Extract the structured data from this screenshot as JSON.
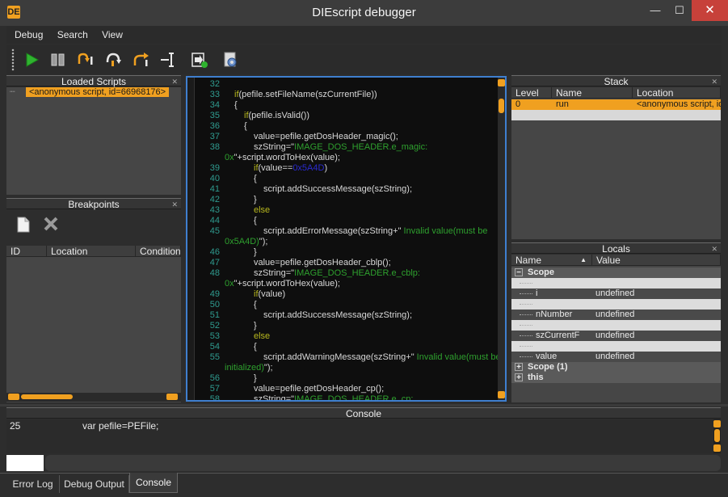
{
  "window": {
    "title": "DIEscript debugger",
    "app_icon": "DE",
    "minimize": "—",
    "maximize": "☐",
    "close": "✕"
  },
  "menu": [
    "Debug",
    "Search",
    "View"
  ],
  "toolbar": {
    "buttons": [
      "run-icon",
      "pause-icon",
      "step-over-icon",
      "step-into-icon",
      "step-out-icon",
      "run-to-cursor-icon",
      "insert-breakpoint-icon",
      "settings-icon"
    ]
  },
  "loaded_scripts": {
    "title": "Loaded Scripts",
    "items": [
      "<anonymous script, id=66968176>"
    ]
  },
  "breakpoints": {
    "title": "Breakpoints",
    "columns": [
      "ID",
      "Location",
      "Condition"
    ]
  },
  "stack": {
    "title": "Stack",
    "columns": [
      "Level",
      "Name",
      "Location"
    ],
    "rows": [
      {
        "level": "0",
        "name": "run",
        "location": "<anonymous script, id"
      }
    ]
  },
  "locals": {
    "title": "Locals",
    "columns": [
      "Name",
      "Value"
    ],
    "rows": [
      {
        "name": "Scope",
        "value": "",
        "bold": true,
        "expander": "−"
      },
      {
        "name": "",
        "value": "",
        "blank": true
      },
      {
        "name": "i",
        "value": "undefined"
      },
      {
        "name": "",
        "value": "",
        "blank": true
      },
      {
        "name": "nNumber",
        "value": "undefined"
      },
      {
        "name": "",
        "value": "",
        "blank": true
      },
      {
        "name": "szCurrentF",
        "value": "undefined"
      },
      {
        "name": "",
        "value": "",
        "blank": true
      },
      {
        "name": "value",
        "value": "undefined"
      },
      {
        "name": "Scope (1)",
        "value": "",
        "bold": true,
        "expander": "+"
      },
      {
        "name": "this",
        "value": "",
        "bold": true,
        "expander": "+"
      }
    ]
  },
  "code": [
    {
      "n": "32",
      "indent": 0,
      "parts": []
    },
    {
      "n": "33",
      "indent": 1,
      "parts": [
        [
          "kw",
          "if"
        ],
        [
          "t",
          "(pefile.setFileName(szCurrentFile))"
        ]
      ]
    },
    {
      "n": "34",
      "indent": 1,
      "parts": [
        [
          "t",
          "{"
        ]
      ]
    },
    {
      "n": "35",
      "indent": 2,
      "parts": [
        [
          "kw",
          "if"
        ],
        [
          "t",
          "(pefile.isValid())"
        ]
      ]
    },
    {
      "n": "36",
      "indent": 2,
      "parts": [
        [
          "t",
          "{"
        ]
      ]
    },
    {
      "n": "37",
      "indent": 3,
      "parts": [
        [
          "t",
          "value=pefile.getDosHeader_magic();"
        ]
      ]
    },
    {
      "n": "38",
      "indent": 3,
      "parts": [
        [
          "t",
          "szString=\""
        ],
        [
          "str",
          "IMAGE_DOS_HEADER.e_magic:"
        ]
      ]
    },
    {
      "n": "",
      "indent": 0,
      "parts": [
        [
          "str",
          "0x"
        ],
        [
          "t",
          "\"+script.wordToHex(value);"
        ]
      ]
    },
    {
      "n": "39",
      "indent": 3,
      "parts": [
        [
          "kw",
          "if"
        ],
        [
          "t",
          "(value=="
        ],
        [
          "num",
          "0x5A4D"
        ],
        [
          "t",
          ")"
        ]
      ]
    },
    {
      "n": "40",
      "indent": 3,
      "parts": [
        [
          "t",
          "{"
        ]
      ]
    },
    {
      "n": "41",
      "indent": 4,
      "parts": [
        [
          "t",
          "script.addSuccessMessage(szString);"
        ]
      ]
    },
    {
      "n": "42",
      "indent": 3,
      "parts": [
        [
          "t",
          "}"
        ]
      ]
    },
    {
      "n": "43",
      "indent": 3,
      "parts": [
        [
          "kw",
          "else"
        ]
      ]
    },
    {
      "n": "44",
      "indent": 3,
      "parts": [
        [
          "t",
          "{"
        ]
      ]
    },
    {
      "n": "45",
      "indent": 4,
      "parts": [
        [
          "t",
          "script.addErrorMessage(szString+\""
        ],
        [
          "str",
          " Invalid value(must be"
        ]
      ]
    },
    {
      "n": "",
      "indent": 0,
      "parts": [
        [
          "str",
          "0x5A4D)"
        ],
        [
          "t",
          "\");"
        ]
      ]
    },
    {
      "n": "46",
      "indent": 3,
      "parts": [
        [
          "t",
          "}"
        ]
      ]
    },
    {
      "n": "47",
      "indent": 3,
      "parts": [
        [
          "t",
          "value=pefile.getDosHeader_cblp();"
        ]
      ]
    },
    {
      "n": "48",
      "indent": 3,
      "parts": [
        [
          "t",
          "szString=\""
        ],
        [
          "str",
          "IMAGE_DOS_HEADER.e_cblp:"
        ]
      ]
    },
    {
      "n": "",
      "indent": 0,
      "parts": [
        [
          "str",
          "0x"
        ],
        [
          "t",
          "\"+script.wordToHex(value);"
        ]
      ]
    },
    {
      "n": "49",
      "indent": 3,
      "parts": [
        [
          "kw",
          "if"
        ],
        [
          "t",
          "(value)"
        ]
      ]
    },
    {
      "n": "50",
      "indent": 3,
      "parts": [
        [
          "t",
          "{"
        ]
      ]
    },
    {
      "n": "51",
      "indent": 4,
      "parts": [
        [
          "t",
          "script.addSuccessMessage(szString);"
        ]
      ]
    },
    {
      "n": "52",
      "indent": 3,
      "parts": [
        [
          "t",
          "}"
        ]
      ]
    },
    {
      "n": "53",
      "indent": 3,
      "parts": [
        [
          "kw",
          "else"
        ]
      ]
    },
    {
      "n": "54",
      "indent": 3,
      "parts": [
        [
          "t",
          "{"
        ]
      ]
    },
    {
      "n": "55",
      "indent": 4,
      "parts": [
        [
          "t",
          "script.addWarningMessage(szString+\""
        ],
        [
          "str",
          " Invalid value(must be"
        ]
      ]
    },
    {
      "n": "",
      "indent": 0,
      "parts": [
        [
          "str",
          "initialized)"
        ],
        [
          "t",
          "\");"
        ]
      ]
    },
    {
      "n": "56",
      "indent": 3,
      "parts": [
        [
          "t",
          "}"
        ]
      ]
    },
    {
      "n": "57",
      "indent": 3,
      "parts": [
        [
          "t",
          "value=pefile.getDosHeader_cp();"
        ]
      ]
    },
    {
      "n": "58",
      "indent": 3,
      "parts": [
        [
          "t",
          "szString=\""
        ],
        [
          "str",
          "IMAGE_DOS_HEADER.e_cp:"
        ]
      ]
    }
  ],
  "console": {
    "title": "Console",
    "line_number": "25",
    "line_text": "var pefile=PEFile;",
    "input_value": ""
  },
  "bottom_tabs": [
    "Error Log",
    "Debug Output",
    "Console"
  ],
  "active_tab": "Console",
  "colors": {
    "accent": "#f0a020",
    "editor_border": "#3f7fcf",
    "keyword": "#b8b81e",
    "string": "#2ea02e",
    "number": "#2a2acf",
    "line_number": "#2f9b8f"
  }
}
